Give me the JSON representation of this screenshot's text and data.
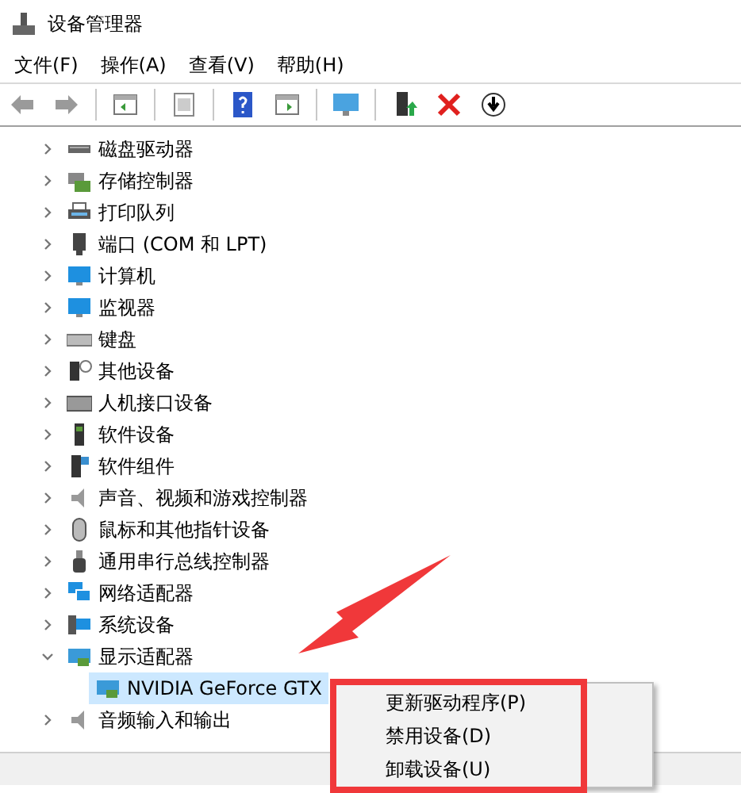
{
  "window": {
    "title": "设备管理器"
  },
  "menu": [
    "文件(F)",
    "操作(A)",
    "查看(V)",
    "帮助(H)"
  ],
  "tree": {
    "items": [
      {
        "label": "磁盘驱动器",
        "expanded": false
      },
      {
        "label": "存储控制器",
        "expanded": false
      },
      {
        "label": "打印队列",
        "expanded": false
      },
      {
        "label": "端口 (COM 和 LPT)",
        "expanded": false
      },
      {
        "label": "计算机",
        "expanded": false
      },
      {
        "label": "监视器",
        "expanded": false
      },
      {
        "label": "键盘",
        "expanded": false
      },
      {
        "label": "其他设备",
        "expanded": false
      },
      {
        "label": "人机接口设备",
        "expanded": false
      },
      {
        "label": "软件设备",
        "expanded": false
      },
      {
        "label": "软件组件",
        "expanded": false
      },
      {
        "label": "声音、视频和游戏控制器",
        "expanded": false
      },
      {
        "label": "鼠标和其他指针设备",
        "expanded": false
      },
      {
        "label": "通用串行总线控制器",
        "expanded": false
      },
      {
        "label": "网络适配器",
        "expanded": false
      },
      {
        "label": "系统设备",
        "expanded": false
      },
      {
        "label": "显示适配器",
        "expanded": true,
        "children": [
          {
            "label": "NVIDIA GeForce GTX",
            "selected": true
          }
        ]
      },
      {
        "label": "音频输入和输出",
        "expanded": false
      }
    ]
  },
  "context_menu": [
    "更新驱动程序(P)",
    "禁用设备(D)",
    "卸载设备(U)"
  ]
}
